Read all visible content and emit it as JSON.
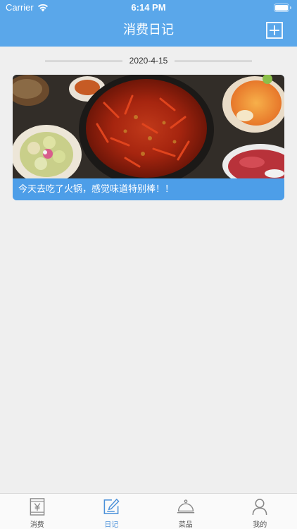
{
  "status_bar": {
    "carrier": "Carrier",
    "time": "6:14 PM"
  },
  "nav": {
    "title": "消费日记",
    "add_icon": "plus-square-icon"
  },
  "entries": [
    {
      "date": "2020-4-15",
      "caption": "今天去吃了火锅，感觉味道特别棒！！"
    }
  ],
  "tabs": [
    {
      "label": "消费",
      "icon": "receipt-yen-icon",
      "active": false
    },
    {
      "label": "日记",
      "icon": "edit-note-icon",
      "active": true
    },
    {
      "label": "菜品",
      "icon": "food-cloche-icon",
      "active": false
    },
    {
      "label": "我的",
      "icon": "person-icon",
      "active": false
    }
  ],
  "colors": {
    "primary": "#5aa7ea",
    "active_tab": "#4a90d9",
    "background": "#efefef"
  }
}
